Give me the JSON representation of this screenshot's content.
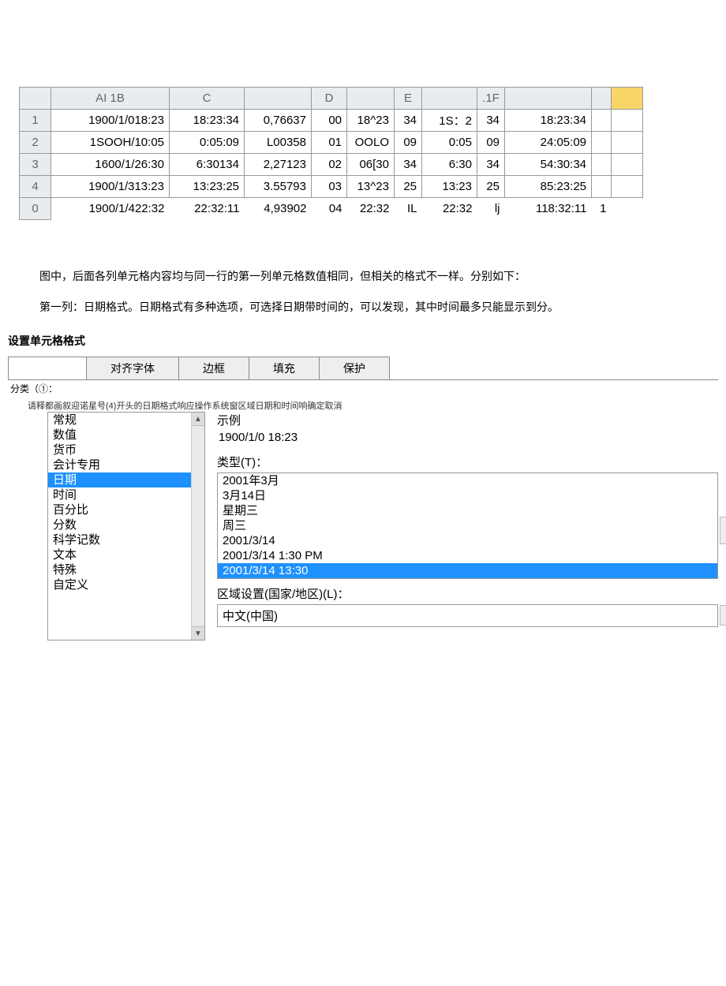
{
  "spreadsheet": {
    "columns": [
      "",
      "AI 1B",
      "C",
      "",
      "D",
      "",
      "E",
      "",
      ".1F",
      "",
      ""
    ],
    "rows": [
      {
        "num": "1",
        "cells": [
          "1900/1/018:23",
          "18:23:34",
          "0,76637",
          "00",
          "18^23",
          "34",
          "1S：2",
          "34",
          "18:23:34",
          "",
          ""
        ]
      },
      {
        "num": "2",
        "cells": [
          "1SOOH/10:05",
          "0:05:09",
          "L00358",
          "01",
          "OOLO",
          "09",
          "0:05",
          "09",
          "24:05:09",
          "",
          ""
        ]
      },
      {
        "num": "3",
        "cells": [
          "1600/1/26:30",
          "6:30134",
          "2,27123",
          "02",
          "06[30",
          "34",
          "6:30",
          "34",
          "54:30:34",
          "",
          ""
        ]
      },
      {
        "num": "4",
        "cells": [
          "1900/1/313:23",
          "13:23:25",
          "3.55793",
          "03",
          "13^23",
          "25",
          "13:23",
          "25",
          "85:23:25",
          "",
          ""
        ]
      },
      {
        "num": "0",
        "cells": [
          "1900/1/422:32",
          "22:32:11",
          "4,93902",
          "04",
          "22:32",
          "IL",
          "22:32",
          "lj",
          "118:32:11",
          "1",
          ""
        ]
      }
    ]
  },
  "paragraphs": {
    "p1": "图中，后面各列单元格内容均与同一行的第一列单元格数值相同，但相关的格式不一样。分别如下：",
    "p2": "第一列：日期格式。日期格式有多种选项，可选择日期带时间的，可以发现，其中时间最多只能显示到分。"
  },
  "dialog": {
    "title": "设置单元格格式",
    "tabs": {
      "t0": "",
      "t1": "对齐字体",
      "t2": "边框",
      "t3": "填充",
      "t4": "保护"
    },
    "category_label": "分类（①：",
    "help_text_prefix": "请释都画叙迎诺星号(4)开头的日期格式响应操作系统窗区域日期和时间响",
    "ok_btn": "确定",
    "cancel_btn": "取消",
    "categories": {
      "c0": "常规",
      "c1": "数值",
      "c2": "货币",
      "c3": "会计专用",
      "c4": "日期",
      "c5": "时间",
      "c6": "百分比",
      "c7": "分数",
      "c8": "科学记数",
      "c9": "文本",
      "c10": "特殊",
      "c11": "自定义"
    },
    "sample_label": "示例",
    "sample_value": "1900/1/0 18:23",
    "type_label": "类型(T)：",
    "types": {
      "t0": "2001年3月",
      "t1": "3月14日",
      "t2": "星期三",
      "t3": "周三",
      "t4": "2001/3/14",
      "t5": "2001/3/14 1:30 PM",
      "t6": "2001/3/14 13:30"
    },
    "locale_label": "区域设置(国家/地区)(L)：",
    "locale_value": "中文(中国)"
  }
}
